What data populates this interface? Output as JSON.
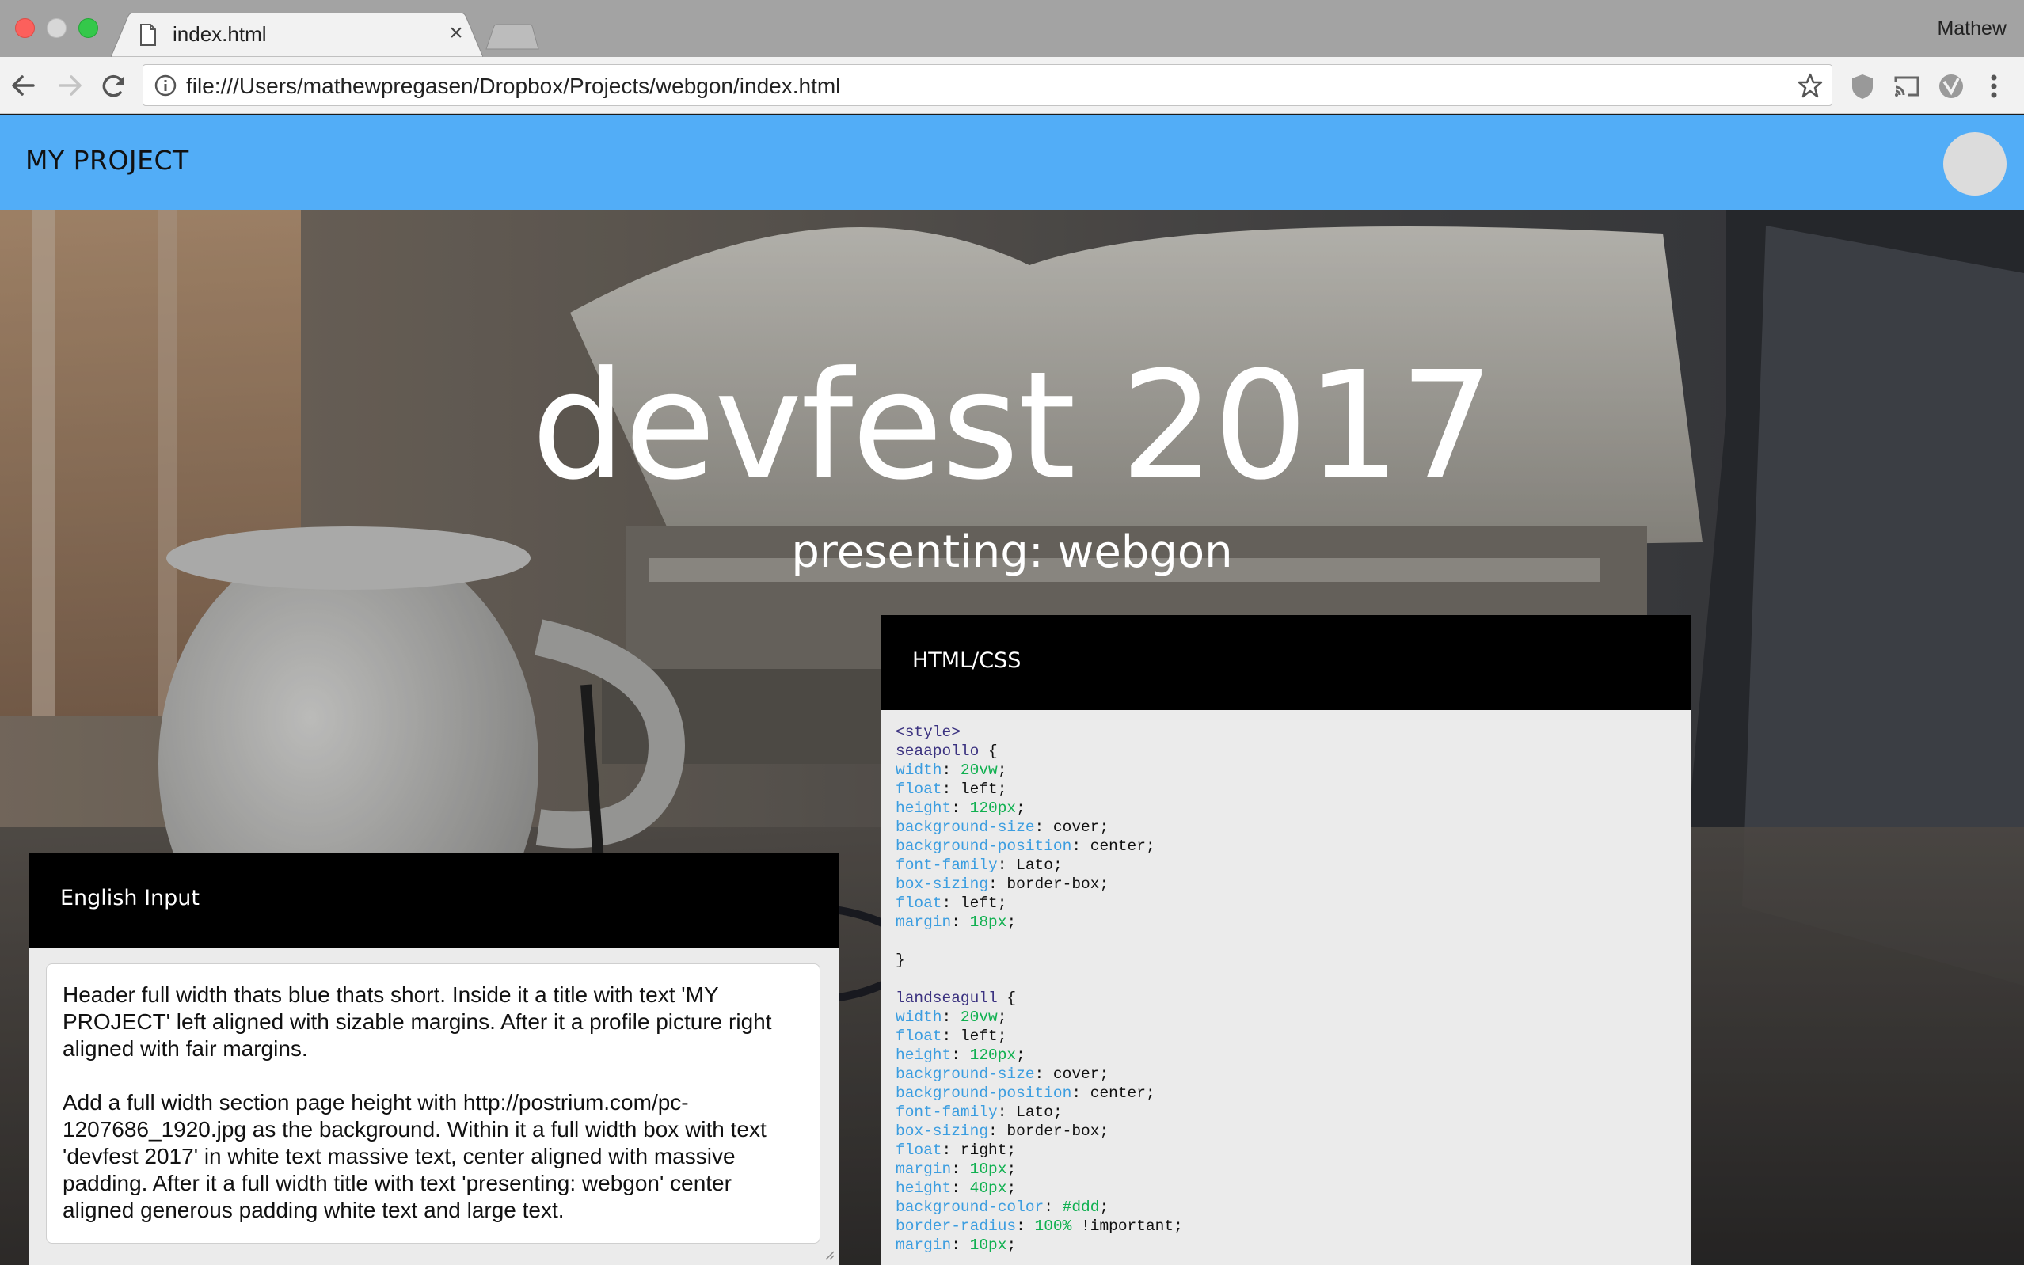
{
  "browser": {
    "tab_title": "index.html",
    "tab_close": "×",
    "profile_name": "Mathew",
    "url": "file:///Users/mathewpregasen/Dropbox/Projects/webgon/index.html",
    "icons": [
      "file-icon",
      "back-arrow-icon",
      "forward-arrow-icon",
      "reload-icon",
      "info-icon",
      "star-icon",
      "shield-extension-icon",
      "cast-icon",
      "circle-extension-icon",
      "menu-dots-icon"
    ]
  },
  "site": {
    "header_title": "MY PROJECT",
    "hero_title": "devfest 2017",
    "hero_subtitle": "presenting: webgon",
    "header_color": "#52adf7"
  },
  "code_panel": {
    "title": "HTML/CSS",
    "lines": [
      [
        [
          "tag",
          "<style>"
        ]
      ],
      [
        [
          "sel",
          "seaapollo"
        ],
        [
          "plain",
          " {"
        ]
      ],
      [
        [
          "prop",
          "width"
        ],
        [
          "plain",
          ": "
        ],
        [
          "num",
          "20vw"
        ],
        [
          "plain",
          ";"
        ]
      ],
      [
        [
          "prop",
          "float"
        ],
        [
          "plain",
          ": left;"
        ]
      ],
      [
        [
          "prop",
          "height"
        ],
        [
          "plain",
          ": "
        ],
        [
          "num",
          "120px"
        ],
        [
          "plain",
          ";"
        ]
      ],
      [
        [
          "prop",
          "background-size"
        ],
        [
          "plain",
          ": cover;"
        ]
      ],
      [
        [
          "prop",
          "background-position"
        ],
        [
          "plain",
          ": center;"
        ]
      ],
      [
        [
          "prop",
          "font-family"
        ],
        [
          "plain",
          ": Lato;"
        ]
      ],
      [
        [
          "prop",
          "box-sizing"
        ],
        [
          "plain",
          ": border-box;"
        ]
      ],
      [
        [
          "prop",
          "float"
        ],
        [
          "plain",
          ": left;"
        ]
      ],
      [
        [
          "prop",
          "margin"
        ],
        [
          "plain",
          ": "
        ],
        [
          "num",
          "18px"
        ],
        [
          "plain",
          ";"
        ]
      ],
      [],
      [
        [
          "plain",
          "}"
        ]
      ],
      [],
      [
        [
          "sel",
          "landseagull"
        ],
        [
          "plain",
          " {"
        ]
      ],
      [
        [
          "prop",
          "width"
        ],
        [
          "plain",
          ": "
        ],
        [
          "num",
          "20vw"
        ],
        [
          "plain",
          ";"
        ]
      ],
      [
        [
          "prop",
          "float"
        ],
        [
          "plain",
          ": left;"
        ]
      ],
      [
        [
          "prop",
          "height"
        ],
        [
          "plain",
          ": "
        ],
        [
          "num",
          "120px"
        ],
        [
          "plain",
          ";"
        ]
      ],
      [
        [
          "prop",
          "background-size"
        ],
        [
          "plain",
          ": cover;"
        ]
      ],
      [
        [
          "prop",
          "background-position"
        ],
        [
          "plain",
          ": center;"
        ]
      ],
      [
        [
          "prop",
          "font-family"
        ],
        [
          "plain",
          ": Lato;"
        ]
      ],
      [
        [
          "prop",
          "box-sizing"
        ],
        [
          "plain",
          ": border-box;"
        ]
      ],
      [
        [
          "prop",
          "float"
        ],
        [
          "plain",
          ": right;"
        ]
      ],
      [
        [
          "prop",
          "margin"
        ],
        [
          "plain",
          ": "
        ],
        [
          "num",
          "10px"
        ],
        [
          "plain",
          ";"
        ]
      ],
      [
        [
          "prop",
          "height"
        ],
        [
          "plain",
          ": "
        ],
        [
          "num",
          "40px"
        ],
        [
          "plain",
          ";"
        ]
      ],
      [
        [
          "prop",
          "background-color"
        ],
        [
          "plain",
          ": "
        ],
        [
          "num",
          "#ddd"
        ],
        [
          "plain",
          ";"
        ]
      ],
      [
        [
          "prop",
          "border-radius"
        ],
        [
          "plain",
          ": "
        ],
        [
          "num",
          "100%"
        ],
        [
          "plain",
          " !important;"
        ]
      ],
      [
        [
          "prop",
          "margin"
        ],
        [
          "plain",
          ": "
        ],
        [
          "num",
          "10px"
        ],
        [
          "plain",
          ";"
        ]
      ]
    ]
  },
  "input_panel": {
    "title": "English Input",
    "text": "Header full width thats blue thats short. Inside it a title with text 'MY PROJECT' left aligned with sizable margins. After it a profile picture right aligned with fair margins.\n\nAdd a full width section page height with http://postrium.com/pc-1207686_1920.jpg as the background. Within it a full width box with text 'devfest 2017' in white text massive text, center aligned with massive padding. After it a full width title with text 'presenting: webgon' center aligned generous padding white text and large text."
  }
}
